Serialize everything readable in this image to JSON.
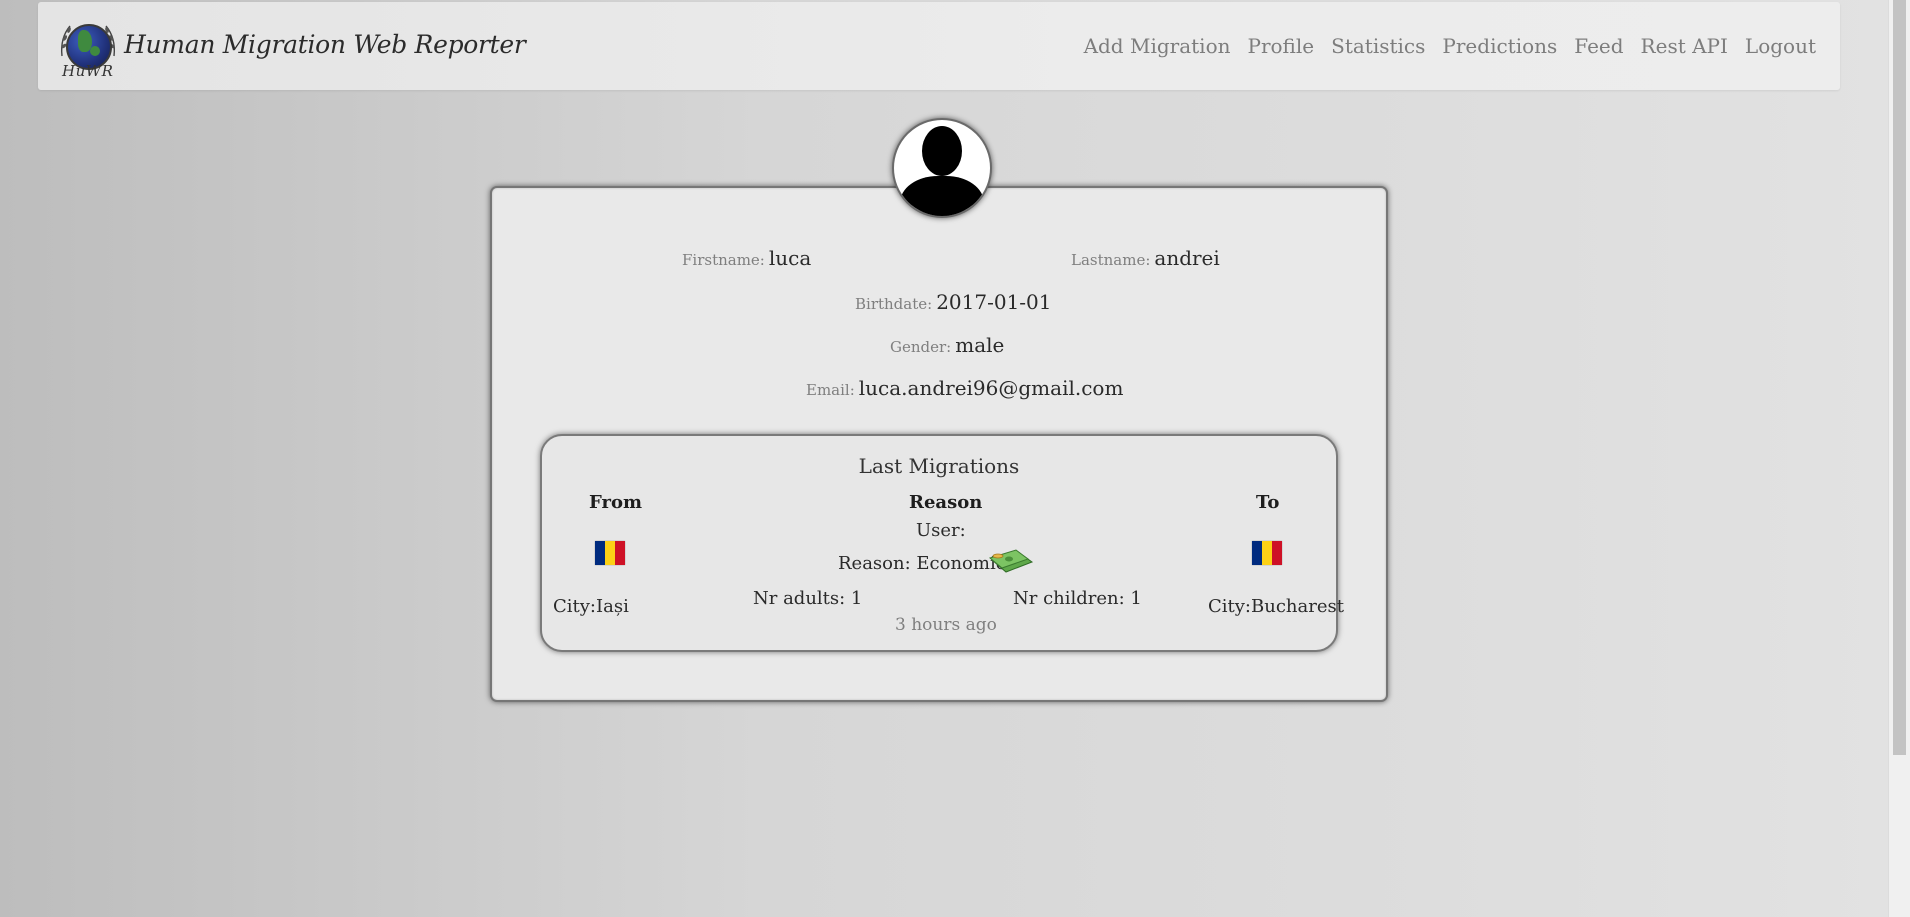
{
  "navbar": {
    "logo_text": "HuWR",
    "brand": "Human Migration Web Reporter",
    "links": [
      "Add Migration",
      "Profile",
      "Statistics",
      "Predictions",
      "Feed",
      "Rest API",
      "Logout"
    ]
  },
  "profile": {
    "firstname_label": "Firstname:",
    "firstname": "luca",
    "lastname_label": "Lastname:",
    "lastname": "andrei",
    "birthdate_label": "Birthdate:",
    "birthdate": "2017-01-01",
    "gender_label": "Gender:",
    "gender": "male",
    "email_label": "Email:",
    "email": "luca.andrei96@gmail.com"
  },
  "migrations": {
    "title": "Last Migrations",
    "headers": {
      "from": "From",
      "reason": "Reason",
      "to": "To"
    },
    "user": "User:",
    "reason": "Reason: Economics",
    "from_city": "City:Iași",
    "to_city": "City:Bucharest",
    "adults": "Nr adults: 1",
    "children": "Nr children: 1",
    "time": "3 hours ago",
    "flag_colors": [
      "#002B7F",
      "#FCD116",
      "#CE1126"
    ]
  },
  "icons": {
    "avatar": "user-silhouette-icon",
    "reason": "money-icon",
    "flag": "romania-flag-icon"
  }
}
